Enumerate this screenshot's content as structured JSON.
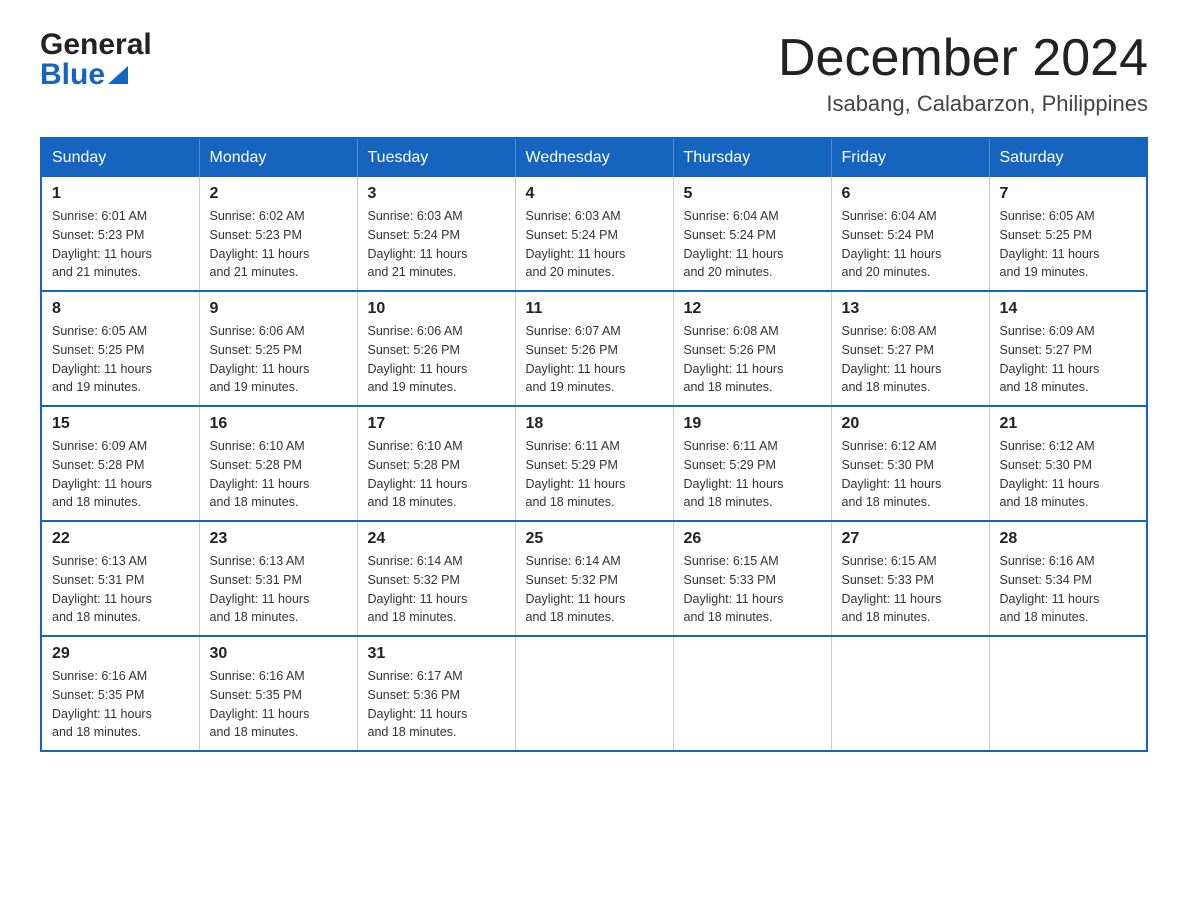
{
  "header": {
    "logo": {
      "general": "General",
      "blue": "Blue",
      "triangle_color": "#1565c0"
    },
    "title": "December 2024",
    "subtitle": "Isabang, Calabarzon, Philippines"
  },
  "calendar": {
    "header_color": "#1565c0",
    "days": [
      "Sunday",
      "Monday",
      "Tuesday",
      "Wednesday",
      "Thursday",
      "Friday",
      "Saturday"
    ],
    "weeks": [
      [
        {
          "date": "1",
          "sunrise": "6:01 AM",
          "sunset": "5:23 PM",
          "daylight": "11 hours and 21 minutes."
        },
        {
          "date": "2",
          "sunrise": "6:02 AM",
          "sunset": "5:23 PM",
          "daylight": "11 hours and 21 minutes."
        },
        {
          "date": "3",
          "sunrise": "6:03 AM",
          "sunset": "5:24 PM",
          "daylight": "11 hours and 21 minutes."
        },
        {
          "date": "4",
          "sunrise": "6:03 AM",
          "sunset": "5:24 PM",
          "daylight": "11 hours and 20 minutes."
        },
        {
          "date": "5",
          "sunrise": "6:04 AM",
          "sunset": "5:24 PM",
          "daylight": "11 hours and 20 minutes."
        },
        {
          "date": "6",
          "sunrise": "6:04 AM",
          "sunset": "5:24 PM",
          "daylight": "11 hours and 20 minutes."
        },
        {
          "date": "7",
          "sunrise": "6:05 AM",
          "sunset": "5:25 PM",
          "daylight": "11 hours and 19 minutes."
        }
      ],
      [
        {
          "date": "8",
          "sunrise": "6:05 AM",
          "sunset": "5:25 PM",
          "daylight": "11 hours and 19 minutes."
        },
        {
          "date": "9",
          "sunrise": "6:06 AM",
          "sunset": "5:25 PM",
          "daylight": "11 hours and 19 minutes."
        },
        {
          "date": "10",
          "sunrise": "6:06 AM",
          "sunset": "5:26 PM",
          "daylight": "11 hours and 19 minutes."
        },
        {
          "date": "11",
          "sunrise": "6:07 AM",
          "sunset": "5:26 PM",
          "daylight": "11 hours and 19 minutes."
        },
        {
          "date": "12",
          "sunrise": "6:08 AM",
          "sunset": "5:26 PM",
          "daylight": "11 hours and 18 minutes."
        },
        {
          "date": "13",
          "sunrise": "6:08 AM",
          "sunset": "5:27 PM",
          "daylight": "11 hours and 18 minutes."
        },
        {
          "date": "14",
          "sunrise": "6:09 AM",
          "sunset": "5:27 PM",
          "daylight": "11 hours and 18 minutes."
        }
      ],
      [
        {
          "date": "15",
          "sunrise": "6:09 AM",
          "sunset": "5:28 PM",
          "daylight": "11 hours and 18 minutes."
        },
        {
          "date": "16",
          "sunrise": "6:10 AM",
          "sunset": "5:28 PM",
          "daylight": "11 hours and 18 minutes."
        },
        {
          "date": "17",
          "sunrise": "6:10 AM",
          "sunset": "5:28 PM",
          "daylight": "11 hours and 18 minutes."
        },
        {
          "date": "18",
          "sunrise": "6:11 AM",
          "sunset": "5:29 PM",
          "daylight": "11 hours and 18 minutes."
        },
        {
          "date": "19",
          "sunrise": "6:11 AM",
          "sunset": "5:29 PM",
          "daylight": "11 hours and 18 minutes."
        },
        {
          "date": "20",
          "sunrise": "6:12 AM",
          "sunset": "5:30 PM",
          "daylight": "11 hours and 18 minutes."
        },
        {
          "date": "21",
          "sunrise": "6:12 AM",
          "sunset": "5:30 PM",
          "daylight": "11 hours and 18 minutes."
        }
      ],
      [
        {
          "date": "22",
          "sunrise": "6:13 AM",
          "sunset": "5:31 PM",
          "daylight": "11 hours and 18 minutes."
        },
        {
          "date": "23",
          "sunrise": "6:13 AM",
          "sunset": "5:31 PM",
          "daylight": "11 hours and 18 minutes."
        },
        {
          "date": "24",
          "sunrise": "6:14 AM",
          "sunset": "5:32 PM",
          "daylight": "11 hours and 18 minutes."
        },
        {
          "date": "25",
          "sunrise": "6:14 AM",
          "sunset": "5:32 PM",
          "daylight": "11 hours and 18 minutes."
        },
        {
          "date": "26",
          "sunrise": "6:15 AM",
          "sunset": "5:33 PM",
          "daylight": "11 hours and 18 minutes."
        },
        {
          "date": "27",
          "sunrise": "6:15 AM",
          "sunset": "5:33 PM",
          "daylight": "11 hours and 18 minutes."
        },
        {
          "date": "28",
          "sunrise": "6:16 AM",
          "sunset": "5:34 PM",
          "daylight": "11 hours and 18 minutes."
        }
      ],
      [
        {
          "date": "29",
          "sunrise": "6:16 AM",
          "sunset": "5:35 PM",
          "daylight": "11 hours and 18 minutes."
        },
        {
          "date": "30",
          "sunrise": "6:16 AM",
          "sunset": "5:35 PM",
          "daylight": "11 hours and 18 minutes."
        },
        {
          "date": "31",
          "sunrise": "6:17 AM",
          "sunset": "5:36 PM",
          "daylight": "11 hours and 18 minutes."
        },
        null,
        null,
        null,
        null
      ]
    ],
    "labels": {
      "sunrise": "Sunrise:",
      "sunset": "Sunset:",
      "daylight": "Daylight:"
    }
  }
}
